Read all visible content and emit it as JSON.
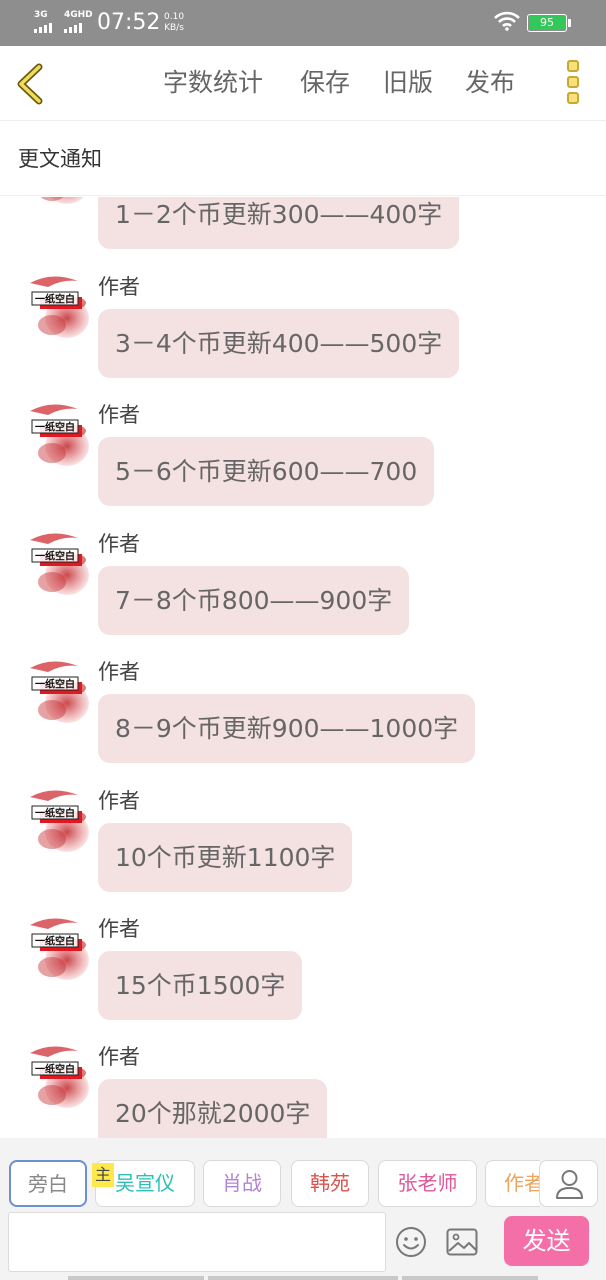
{
  "status_bar": {
    "signal1_label": "3G",
    "signal2_label": "4GHD",
    "time": "07:52",
    "speed_value": "0.10",
    "speed_unit": "KB/s",
    "battery": "95",
    "battery_color": "#34c759"
  },
  "topnav": {
    "back_icon": "chevron-left-icon",
    "items": [
      "字数统计",
      "保存",
      "旧版",
      "发布"
    ],
    "menu_icon": "more-vertical-icon"
  },
  "header": {
    "title": "更文通知"
  },
  "messages": [
    {
      "author": "",
      "text": "1－2个币更新300——400字"
    },
    {
      "author": "作者",
      "text": "3－4个币更新400——500字"
    },
    {
      "author": "作者",
      "text": "5－6个币更新600——700"
    },
    {
      "author": "作者",
      "text": "7－8个币800——900字"
    },
    {
      "author": "作者",
      "text": "8－9个币更新900——1000字"
    },
    {
      "author": "作者",
      "text": "10个币更新1100字"
    },
    {
      "author": "作者",
      "text": "15个币1500字"
    },
    {
      "author": "作者",
      "text": "20个那就2000字"
    }
  ],
  "avatar_stamp_text": "一纸空白",
  "roles": [
    {
      "label": "旁白",
      "color": "#888888"
    },
    {
      "label": "吴宣仪",
      "color": "#2bbfb5"
    },
    {
      "label": "肖战",
      "color": "#b184d6"
    },
    {
      "label": "韩苑",
      "color": "#d9534f"
    },
    {
      "label": "张老师",
      "color": "#e0559b"
    },
    {
      "label": "作者",
      "color": "#f0a35c"
    }
  ],
  "host_tag": "主",
  "input": {
    "value": "",
    "placeholder": ""
  },
  "send_label": "发送",
  "bubble_color": "#f4e1e1",
  "send_color": "#f46fa8"
}
